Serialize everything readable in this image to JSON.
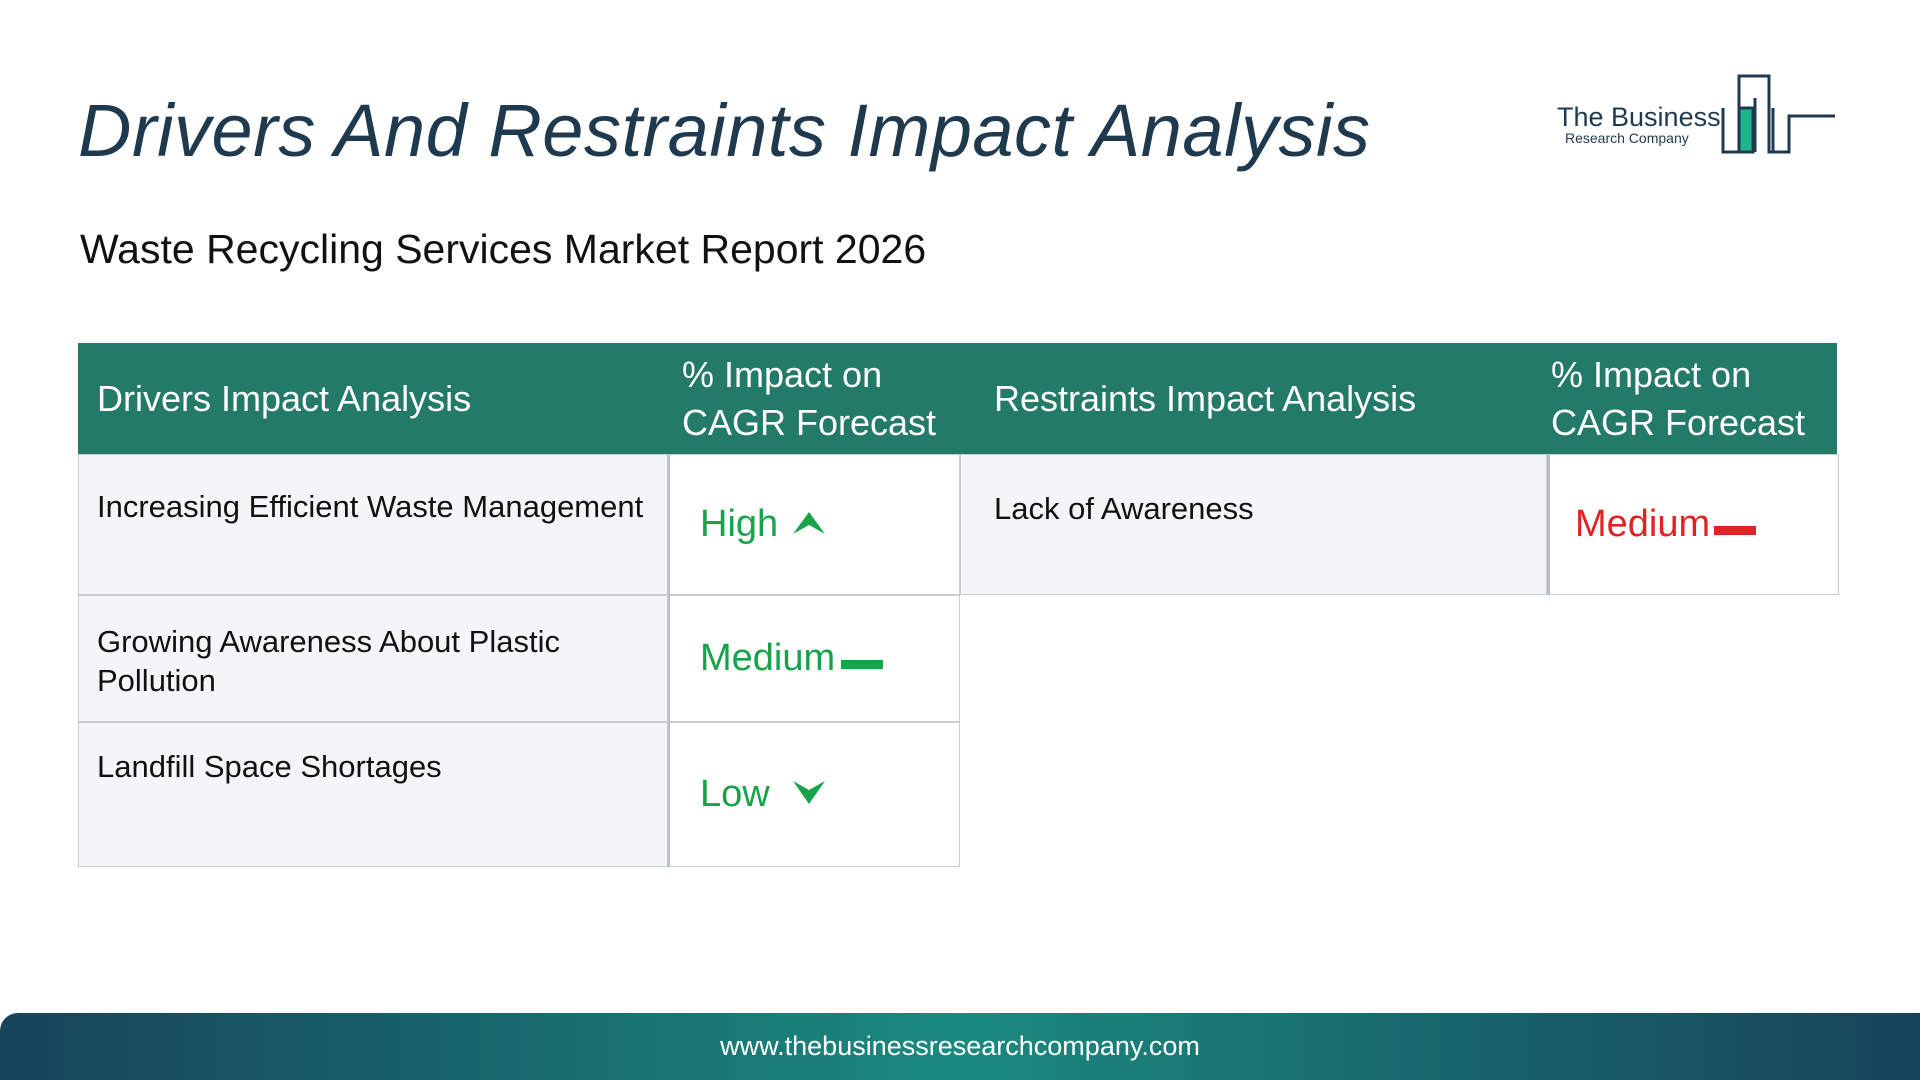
{
  "header": {
    "title": "Drivers And Restraints Impact Analysis",
    "subtitle": "Waste Recycling Services Market Report 2026"
  },
  "logo": {
    "line1": "The Business",
    "line2": "Research Company"
  },
  "table": {
    "drivers_header": "Drivers Impact Analysis",
    "impact_header_line1": "% Impact on",
    "impact_header_line2": "CAGR Forecast",
    "restraints_header": "Restraints Impact Analysis",
    "drivers": [
      {
        "label": "Increasing Efficient Waste Management",
        "impact": "High",
        "icon": "arrow-up-icon"
      },
      {
        "label": "Growing Awareness About Plastic Pollution",
        "impact": "Medium",
        "icon": "dash-icon"
      },
      {
        "label": "Landfill Space Shortages",
        "impact": "Low",
        "icon": "arrow-down-icon"
      }
    ],
    "restraints": [
      {
        "label": "Lack of Awareness",
        "impact": "Medium",
        "icon": "dash-icon"
      }
    ]
  },
  "colors": {
    "header_bg": "#247a69",
    "driver_impact": "#16a34a",
    "restraint_impact": "#e02424",
    "title": "#1f3a4f"
  },
  "footer": {
    "url": "www.thebusinessresearchcompany.com"
  }
}
